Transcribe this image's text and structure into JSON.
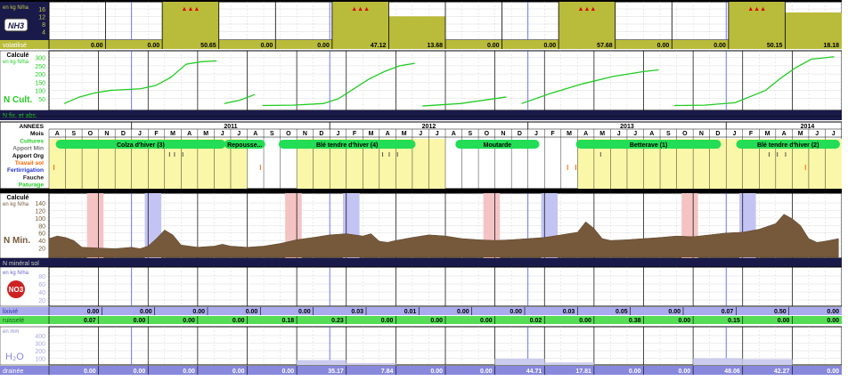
{
  "colors": {
    "olive": "#B9BB3A",
    "olive_strip": "#C6C94A",
    "yellow_zone": "#FBF7A8",
    "dark_navy": "#1A1A4A",
    "green_line": "#22CC22",
    "green_pill": "#22DD55",
    "brown": "#76593A",
    "lavender": "#AAAAEE",
    "water_blue": "#8888DD",
    "ruissele_green": "#55DD55",
    "pink_zone": "#F4C4C4",
    "blue_zone": "#C4C4F4",
    "red": "#DD0000",
    "orange": "#FF6600"
  },
  "nh3": {
    "unit": "en kg N/ha",
    "ticks": [
      "16",
      "12",
      "8",
      "4"
    ],
    "badge": "NH3",
    "label": "volatilisé",
    "values": [
      "0.00",
      "0.00",
      "50.65",
      "0.00",
      "0.00",
      "47.12",
      "13.68",
      "0.00",
      "0.00",
      "57.68",
      "0.00",
      "0.00",
      "50.15",
      "18.18"
    ],
    "cells_full": [
      2,
      5,
      9,
      12
    ],
    "cells_partial": [
      6,
      13
    ],
    "cells_partial_level": [
      0.62,
      0.72
    ],
    "marker": "▲▲▲"
  },
  "ncult": {
    "title": "Calculé",
    "unit": "en kg N/ha",
    "ticks": [
      "300",
      "250",
      "200",
      "150",
      "100",
      "50"
    ],
    "label": "N Cult.",
    "footer": "N fix. et abs."
  },
  "middle": {
    "row_labels": [
      "ANNEES",
      "Mois",
      "Cultures",
      "Apport Min",
      "Apport Org",
      "Travail sol",
      "Fertirrigation",
      "Fauche",
      "Paturage"
    ],
    "years": [
      "2011",
      "2012",
      "2013",
      "2014"
    ],
    "months": [
      "A",
      "S",
      "O",
      "N",
      "D",
      "J",
      "F",
      "M",
      "A",
      "M",
      "J",
      "J",
      "A",
      "S",
      "O",
      "N",
      "D",
      "J",
      "F",
      "M",
      "A",
      "M",
      "J",
      "J",
      "A",
      "S",
      "O",
      "N",
      "D",
      "J",
      "F",
      "M",
      "A",
      "M",
      "J",
      "J",
      "A",
      "S",
      "O",
      "N",
      "D",
      "J",
      "F",
      "M",
      "A",
      "M",
      "J",
      "J"
    ],
    "crops": [
      "Colza d'hiver (3)",
      "Repousse...",
      "Blé tendre d'hiver (4)",
      "Moutarde",
      "Betterave (1)",
      "Blé tendre d'hiver (2)"
    ]
  },
  "nmin": {
    "title": "Calculé",
    "unit": "en kg N/ha",
    "ticks": [
      "140",
      "120",
      "100",
      "80",
      "60",
      "40",
      "20"
    ],
    "label": "N Min.",
    "footer": "N minéral sol"
  },
  "no3": {
    "unit": "en kg N/ha",
    "ticks": [
      "80",
      "60",
      "40",
      "20"
    ],
    "badge": "NO3",
    "lixivie_label": "lixivié",
    "lixivie_values": [
      "0.00",
      "0.00",
      "0.00",
      "0.00",
      "0.00",
      "0.03",
      "0.01",
      "0.00",
      "0.00",
      "0.03",
      "0.05",
      "0.00",
      "0.07",
      "0.50",
      "0.00"
    ],
    "ruissele_label": "ruisselé",
    "ruissele_values": [
      "0.07",
      "0.00",
      "0.00",
      "0.00",
      "0.18",
      "0.23",
      "0.00",
      "0.00",
      "0.00",
      "0.02",
      "0.00",
      "0.38",
      "0.00",
      "0.15",
      "0.00",
      "0.00"
    ]
  },
  "h2o": {
    "unit": "en mm",
    "ticks": [
      "400",
      "300",
      "200",
      "100"
    ],
    "badge": "H₂O",
    "label": "drainée",
    "values": [
      "0.00",
      "0.00",
      "0.00",
      "0.00",
      "0.00",
      "35.17",
      "7.84",
      "0.00",
      "0.00",
      "44.71",
      "17.81",
      "0.00",
      "0.00",
      "48.06",
      "42.27",
      "0.00"
    ]
  },
  "chart_data": [
    {
      "type": "area",
      "title": "N Min.",
      "ylabel": "en kg N/ha",
      "ylim": [
        0,
        140
      ],
      "x_unit": "month index from Aug 2010",
      "x": [
        0,
        0.5,
        1,
        1.5,
        2,
        3,
        4,
        5,
        5.5,
        6,
        6.5,
        7,
        7.5,
        8,
        9,
        10,
        10.5,
        11,
        12,
        13,
        14,
        15,
        16,
        17,
        18,
        19,
        19.5,
        20,
        20.5,
        21,
        22,
        23,
        24,
        25,
        26,
        27,
        28,
        29,
        30,
        31,
        32,
        32.5,
        33,
        33.5,
        34,
        35,
        36,
        37,
        38,
        39,
        40,
        41,
        42,
        43,
        44,
        44.5,
        45,
        45.5,
        46,
        46.5,
        47,
        47.8
      ],
      "y": [
        45,
        52,
        48,
        40,
        22,
        20,
        18,
        22,
        18,
        25,
        45,
        68,
        55,
        28,
        22,
        25,
        30,
        25,
        22,
        25,
        32,
        42,
        48,
        55,
        58,
        52,
        58,
        38,
        35,
        40,
        48,
        55,
        52,
        45,
        42,
        40,
        42,
        45,
        48,
        55,
        62,
        90,
        72,
        45,
        40,
        42,
        45,
        48,
        52,
        50,
        55,
        60,
        62,
        70,
        85,
        110,
        98,
        80,
        45,
        35,
        38,
        45
      ]
    },
    {
      "type": "line",
      "title": "N Cult.",
      "ylabel": "en kg N/ha",
      "ylim": [
        0,
        320
      ],
      "series": [
        {
          "x": [
            1,
            2,
            3,
            4,
            5,
            6,
            7,
            8,
            9,
            10,
            11
          ],
          "y": [
            20,
            60,
            85,
            100,
            105,
            110,
            130,
            180,
            260,
            275,
            280
          ]
        },
        {
          "x": [
            11.5,
            12.5,
            13.5
          ],
          "y": [
            20,
            40,
            75
          ]
        },
        {
          "x": [
            14,
            16,
            18,
            19,
            20,
            21,
            22,
            23,
            24
          ],
          "y": [
            8,
            10,
            20,
            50,
            110,
            170,
            215,
            250,
            265
          ]
        },
        {
          "x": [
            24.5,
            27,
            30
          ],
          "y": [
            5,
            20,
            60
          ]
        },
        {
          "x": [
            31,
            33,
            35,
            37,
            39,
            40
          ],
          "y": [
            20,
            85,
            140,
            185,
            215,
            225
          ]
        },
        {
          "x": [
            41,
            43,
            45,
            47,
            48,
            49,
            50,
            51.5
          ],
          "y": [
            8,
            10,
            25,
            100,
            175,
            240,
            290,
            305
          ]
        }
      ]
    }
  ]
}
